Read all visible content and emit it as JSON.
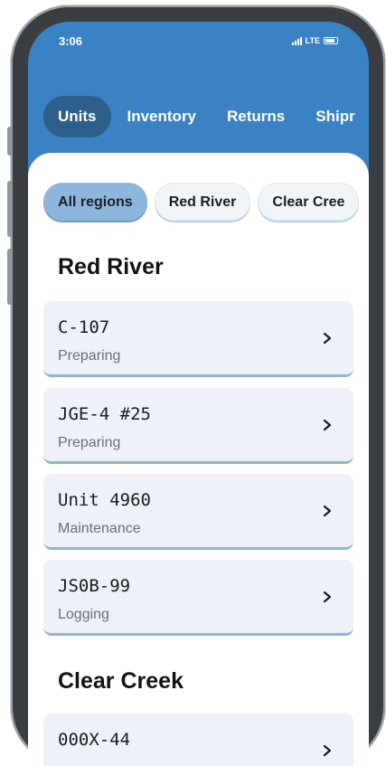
{
  "status_bar": {
    "time": "3:06",
    "network": "LTE"
  },
  "tabs": [
    {
      "label": "Units",
      "active": true
    },
    {
      "label": "Inventory",
      "active": false
    },
    {
      "label": "Returns",
      "active": false
    },
    {
      "label": "Shipr",
      "active": false
    }
  ],
  "chips": [
    {
      "label": "All regions",
      "active": true
    },
    {
      "label": "Red River",
      "active": false
    },
    {
      "label": "Clear Cree",
      "active": false
    }
  ],
  "sections": [
    {
      "title": "Red River",
      "units": [
        {
          "code": "C-107",
          "status": "Preparing"
        },
        {
          "code": "JGE-4 #25",
          "status": "Preparing"
        },
        {
          "code": "Unit 4960",
          "status": "Maintenance"
        },
        {
          "code": "JS0B-99",
          "status": "Logging"
        }
      ]
    },
    {
      "title": "Clear Creek",
      "units": [
        {
          "code": "000X-44",
          "status": ""
        }
      ]
    }
  ],
  "colors": {
    "header": "#3a82c4",
    "active_tab": "#2e5f8a",
    "active_chip": "#8db6dc",
    "card": "#eef1f7",
    "card_accent": "#8fb4da"
  }
}
